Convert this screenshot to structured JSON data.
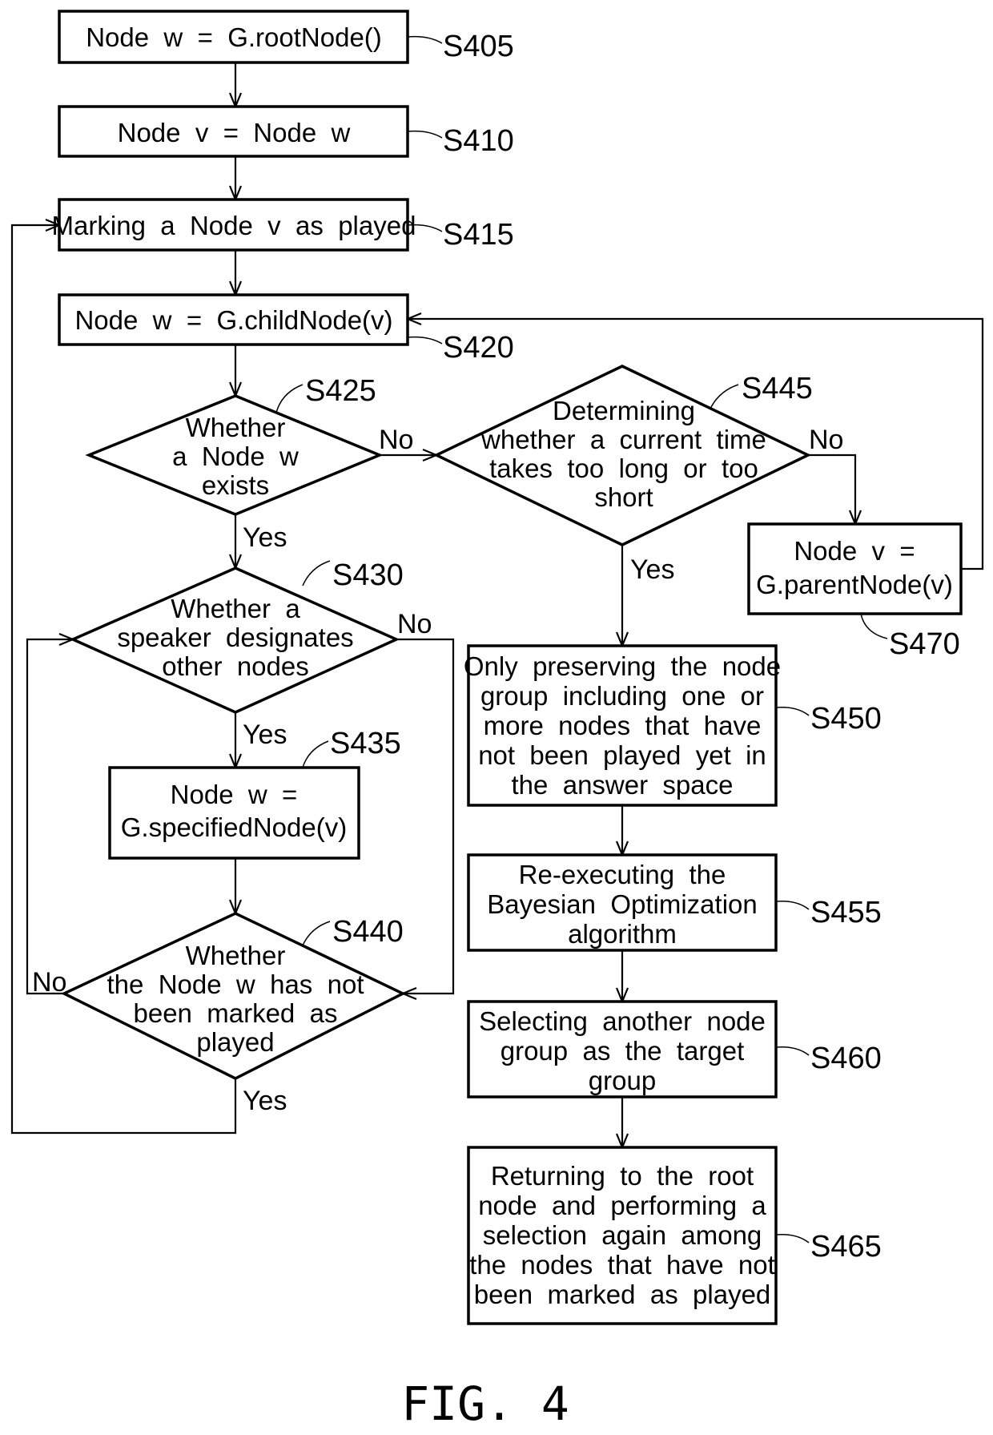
{
  "figure": {
    "caption": "FIG. 4"
  },
  "steps": {
    "s405": {
      "id": "S405",
      "lines": [
        "Node  w  =  G.rootNode()"
      ]
    },
    "s410": {
      "id": "S410",
      "lines": [
        "Node  v  =  Node  w"
      ]
    },
    "s415": {
      "id": "S415",
      "lines": [
        "Marking  a  Node  v  as  played"
      ]
    },
    "s420": {
      "id": "S420",
      "lines": [
        "Node  w  =  G.childNode(v)"
      ]
    },
    "s425": {
      "id": "S425",
      "lines": [
        "Whether",
        "a  Node  w",
        "exists"
      ]
    },
    "s430": {
      "id": "S430",
      "lines": [
        "Whether  a",
        "speaker  designates",
        "other  nodes"
      ]
    },
    "s435": {
      "id": "S435",
      "lines": [
        "Node  w  =",
        "G.specifiedNode(v)"
      ]
    },
    "s440": {
      "id": "S440",
      "lines": [
        "Whether",
        "the  Node  w  has  not",
        "been  marked  as",
        "played"
      ]
    },
    "s445": {
      "id": "S445",
      "lines": [
        "Determining",
        "whether  a  current  time",
        "takes  too  long  or  too",
        "short"
      ]
    },
    "s450": {
      "id": "S450",
      "lines": [
        "Only  preserving  the  node",
        "group  including  one  or",
        "more  nodes  that  have",
        "not  been  played  yet  in",
        "the  answer  space"
      ]
    },
    "s455": {
      "id": "S455",
      "lines": [
        "Re-executing  the",
        "Bayesian  Optimization",
        "algorithm"
      ]
    },
    "s460": {
      "id": "S460",
      "lines": [
        "Selecting  another  node",
        "group  as  the  target",
        "group"
      ]
    },
    "s465": {
      "id": "S465",
      "lines": [
        "Returning  to  the  root",
        "node  and  performing  a",
        "selection  again  among",
        "the  nodes  that  have  not",
        "been  marked  as  played"
      ]
    },
    "s470": {
      "id": "S470",
      "lines": [
        "Node  v  =",
        "G.parentNode(v)"
      ]
    }
  },
  "branch_labels": {
    "s425_no": "No",
    "s425_yes": "Yes",
    "s430_no": "No",
    "s430_yes": "Yes",
    "s440_no": "No",
    "s440_yes": "Yes",
    "s445_no": "No",
    "s445_yes": "Yes"
  }
}
